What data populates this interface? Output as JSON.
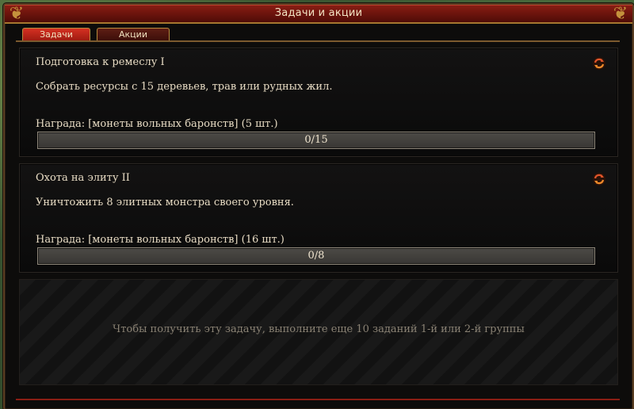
{
  "window": {
    "title": "Задачи и акции"
  },
  "tabs": [
    {
      "label": "Задачи",
      "active": true
    },
    {
      "label": "Акции",
      "active": false
    }
  ],
  "tasks": [
    {
      "title": "Подготовка к ремеслу I",
      "description": "Собрать ресурсы с 15 деревьев, трав или рудных жил.",
      "reward": "Награда:  [монеты вольных баронств] (5 шт.)",
      "progress_text": "0/15",
      "progress_fraction": 0,
      "icon": "refresh-icon"
    },
    {
      "title": "Охота на элиту II",
      "description": "Уничтожить 8 элитных монстра своего уровня.",
      "reward": "Награда:  [монеты вольных баронств] (16 шт.)",
      "progress_text": "0/8",
      "progress_fraction": 0,
      "icon": "refresh-icon"
    }
  ],
  "locked": {
    "message": "Чтобы получить эту задачу, выполните еще 10 заданий 1-й или 2-й группы"
  },
  "colors": {
    "title_bar": "#7a1810",
    "accent_gold": "#b88a3d",
    "text": "#e8dcc4",
    "locked_text": "#8a8274"
  }
}
